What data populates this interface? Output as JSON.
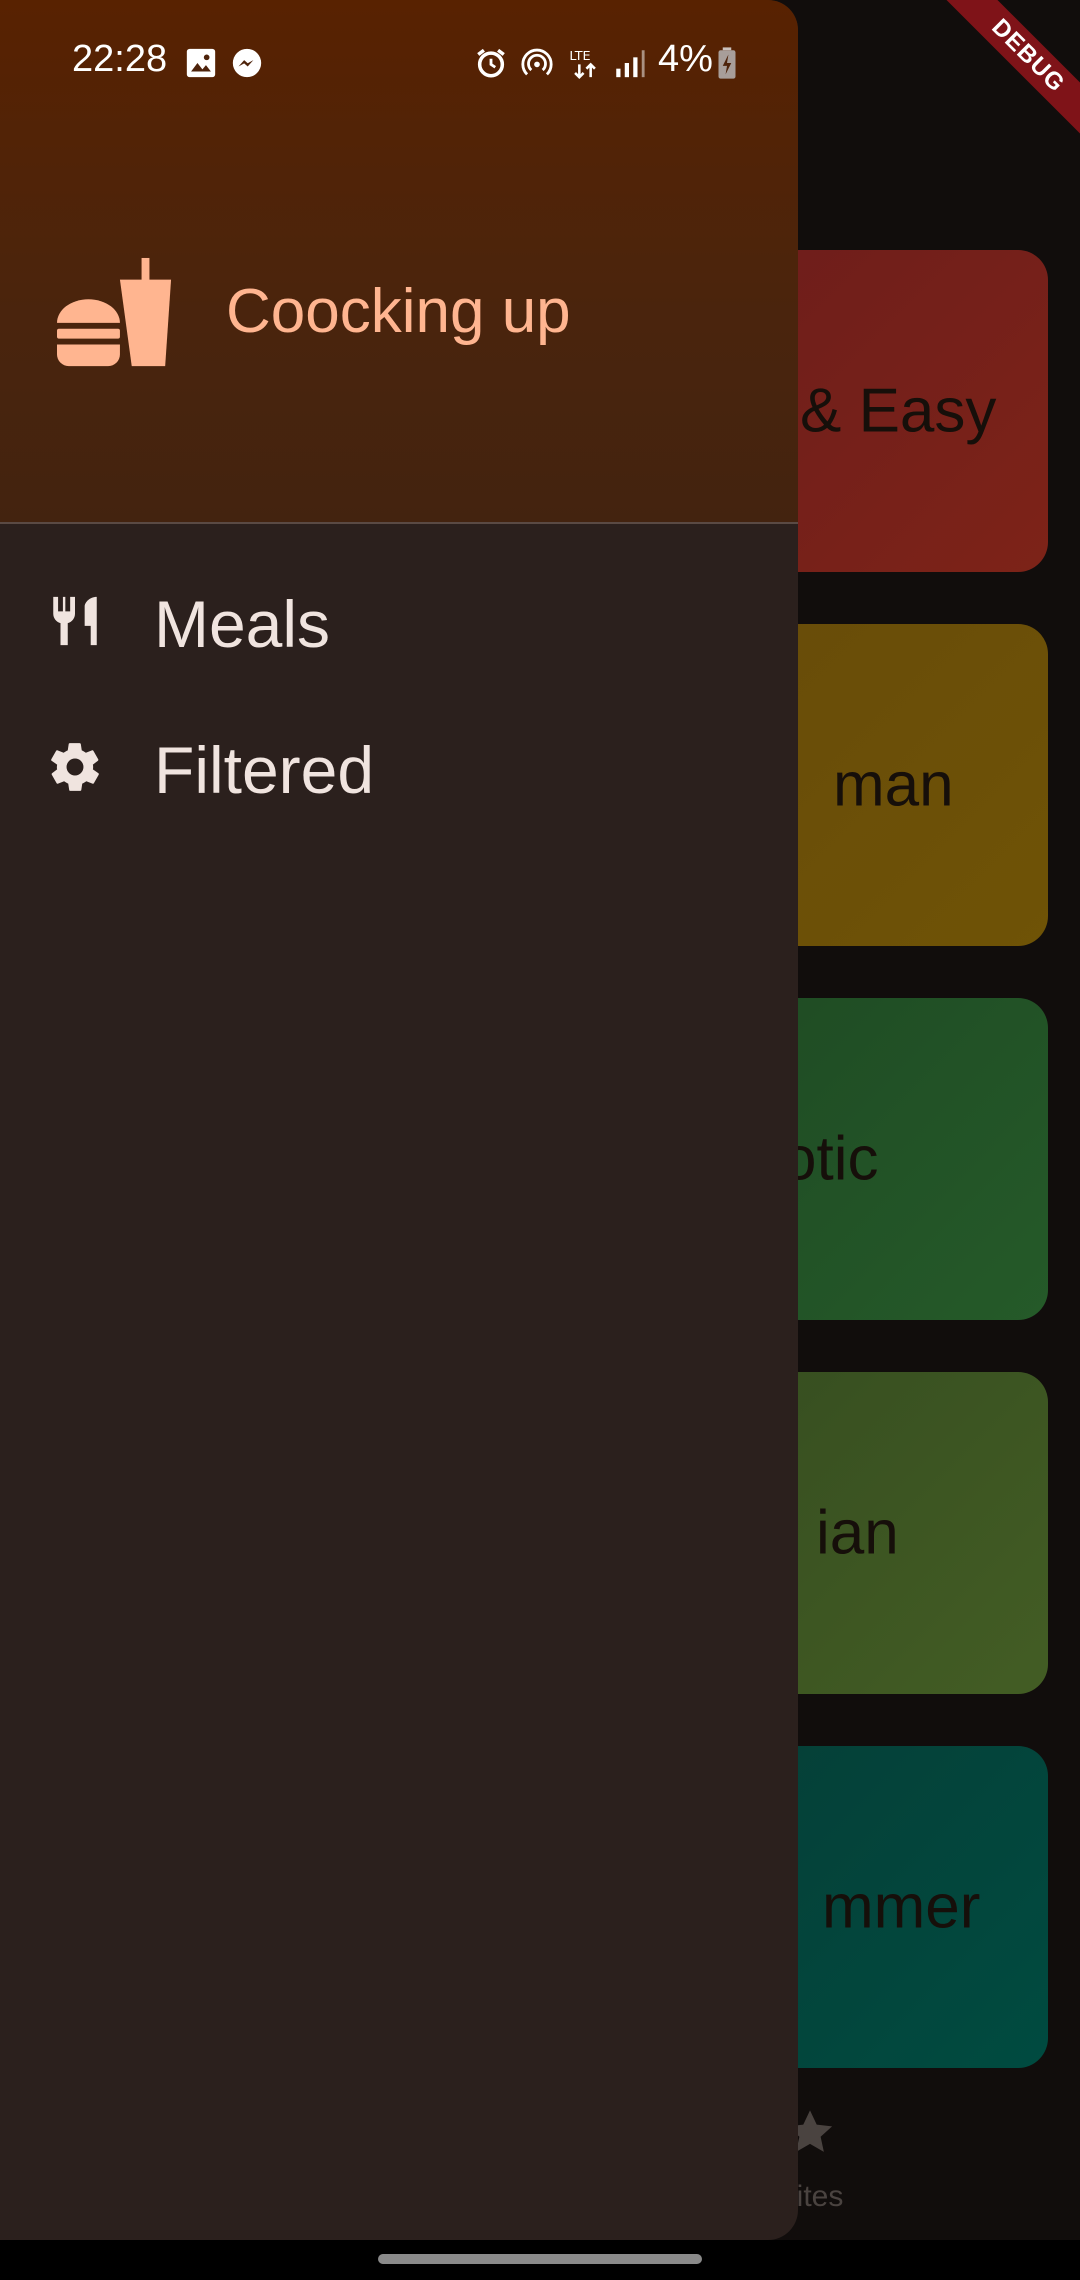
{
  "status_bar": {
    "time": "22:28",
    "battery_percent": "4%",
    "left_icons": [
      "image-icon",
      "messenger-icon"
    ],
    "right_icons": [
      "alarm-icon",
      "hotspot-icon",
      "lte-icon",
      "signal-icon",
      "battery-icon"
    ]
  },
  "debug_banner": "DEBUG",
  "drawer": {
    "header": {
      "icon": "fastfood-icon",
      "title": "Coocking up"
    },
    "items": [
      {
        "icon": "restaurant-icon",
        "label": "Meals"
      },
      {
        "icon": "settings-icon",
        "label": "Filtered"
      }
    ]
  },
  "background": {
    "categories": [
      {
        "visible_label": "& Easy",
        "color": "#6a1c1c"
      },
      {
        "visible_label": "man",
        "color": "#664a0a"
      },
      {
        "visible_label": "otic",
        "color": "#1d4722"
      },
      {
        "visible_label": "ian",
        "color": "#334a1f"
      },
      {
        "visible_label": "mmer",
        "color": "#073c35"
      }
    ],
    "bottom_nav": {
      "favorites_label": "orites",
      "icon": "star-icon"
    }
  },
  "colors": {
    "drawer_header": "#4a240d",
    "drawer_body": "#2b201d",
    "accent": "#ffb590"
  }
}
